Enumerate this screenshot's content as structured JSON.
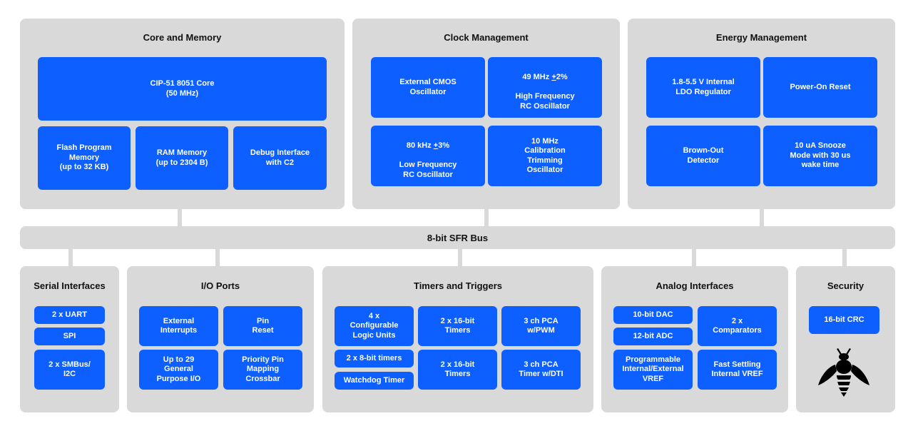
{
  "diagram": {
    "bus_label": "8-bit SFR Bus",
    "block_color": "#0d5fff",
    "panel_color": "#d9d9d9",
    "panels": {
      "core": {
        "title": "Core and Memory",
        "blocks": [
          "CIP-51 8051 Core\n(50 MHz)",
          "Flash Program\nMemory\n(up to 32 KB)",
          "RAM Memory\n(up to 2304 B)",
          "Debug Interface\nwith C2"
        ]
      },
      "clock": {
        "title": "Clock Management",
        "blocks": [
          "External CMOS\nOscillator",
          "High Frequency\nRC Oscillator",
          "Low Frequency\nRC Oscillator",
          "10 MHz\nCalibration\nTrimming\nOscillator"
        ],
        "hf_line1_prefix": "49 MHz ",
        "hf_tol_sign": "+",
        "hf_tol_value": "2%",
        "lf_line1_prefix": "80 kHz ",
        "lf_tol_sign": "+",
        "lf_tol_value": "3%"
      },
      "energy": {
        "title": "Energy Management",
        "blocks": [
          "1.8-5.5 V Internal\nLDO Regulator",
          "Power-On Reset",
          "Brown-Out\nDetector",
          "10 uA Snooze\nMode with 30 us\nwake time"
        ]
      },
      "serial": {
        "title": "Serial Interfaces",
        "blocks": [
          "2 x UART",
          "SPI",
          "2 x SMBus/\nI2C"
        ]
      },
      "io": {
        "title": "I/O Ports",
        "blocks": [
          "External\nInterrupts",
          "Pin\nReset",
          "Up to 29\nGeneral\nPurpose I/O",
          "Priority Pin\nMapping\nCrossbar"
        ]
      },
      "timers": {
        "title": "Timers and Triggers",
        "blocks": [
          "4 x\nConfigurable\nLogic Units",
          "2 x 16-bit\nTimers",
          "3 ch PCA\nw/PWM",
          "2 x 8-bit timers",
          "Watchdog Timer",
          "2 x 16-bit\nTimers",
          "3 ch PCA\nTimer w/DTI"
        ]
      },
      "analog": {
        "title": "Analog Interfaces",
        "blocks": [
          "10-bit DAC",
          "12-bit ADC",
          "2 x\nComparators",
          "Programmable\nInternal/External\nVREF",
          "Fast Settling\nInternal VREF"
        ]
      },
      "security": {
        "title": "Security",
        "blocks": [
          "16-bit CRC"
        ],
        "icon": "bee-icon"
      }
    }
  }
}
